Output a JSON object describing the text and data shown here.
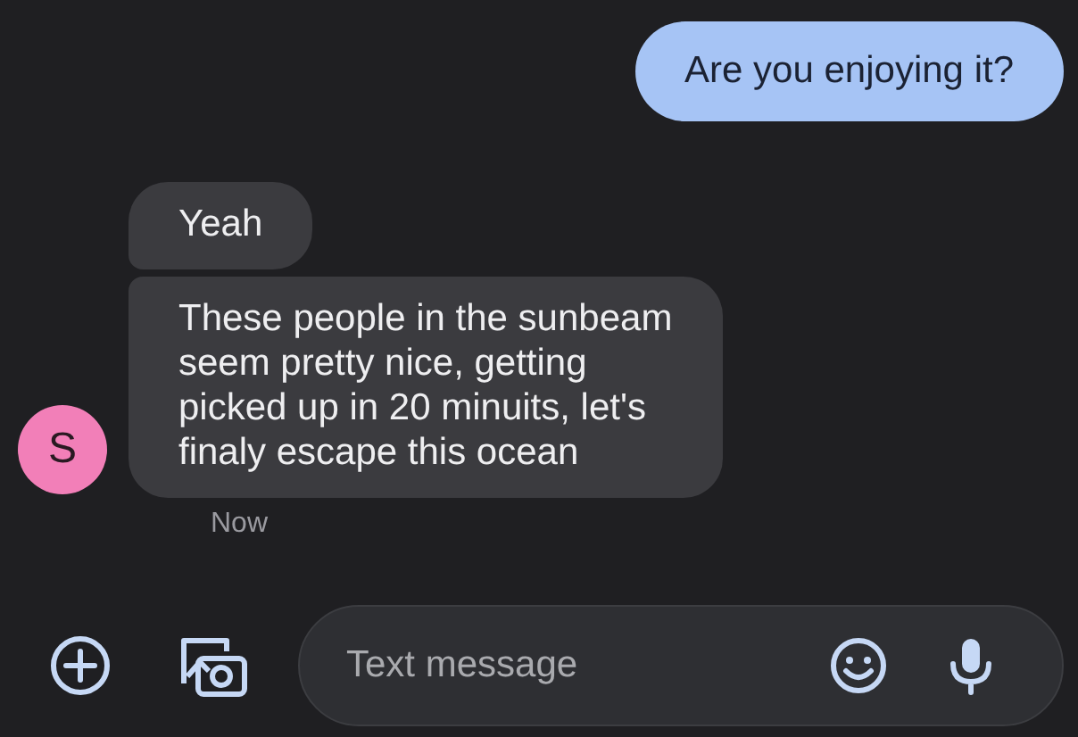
{
  "messages": [
    {
      "kind": "outgoing",
      "text": "Are you enjoying it?"
    },
    {
      "kind": "incoming",
      "text": "Yeah"
    },
    {
      "kind": "incoming",
      "text": "These people in the sunbeam\nseem pretty nice, getting\npicked up in 20 minuits, let's\nfinaly escape this ocean"
    }
  ],
  "sender": {
    "initial": "S",
    "color": "#f27fb8"
  },
  "timestamp": "Now",
  "composer": {
    "placeholder": "Text message"
  }
}
